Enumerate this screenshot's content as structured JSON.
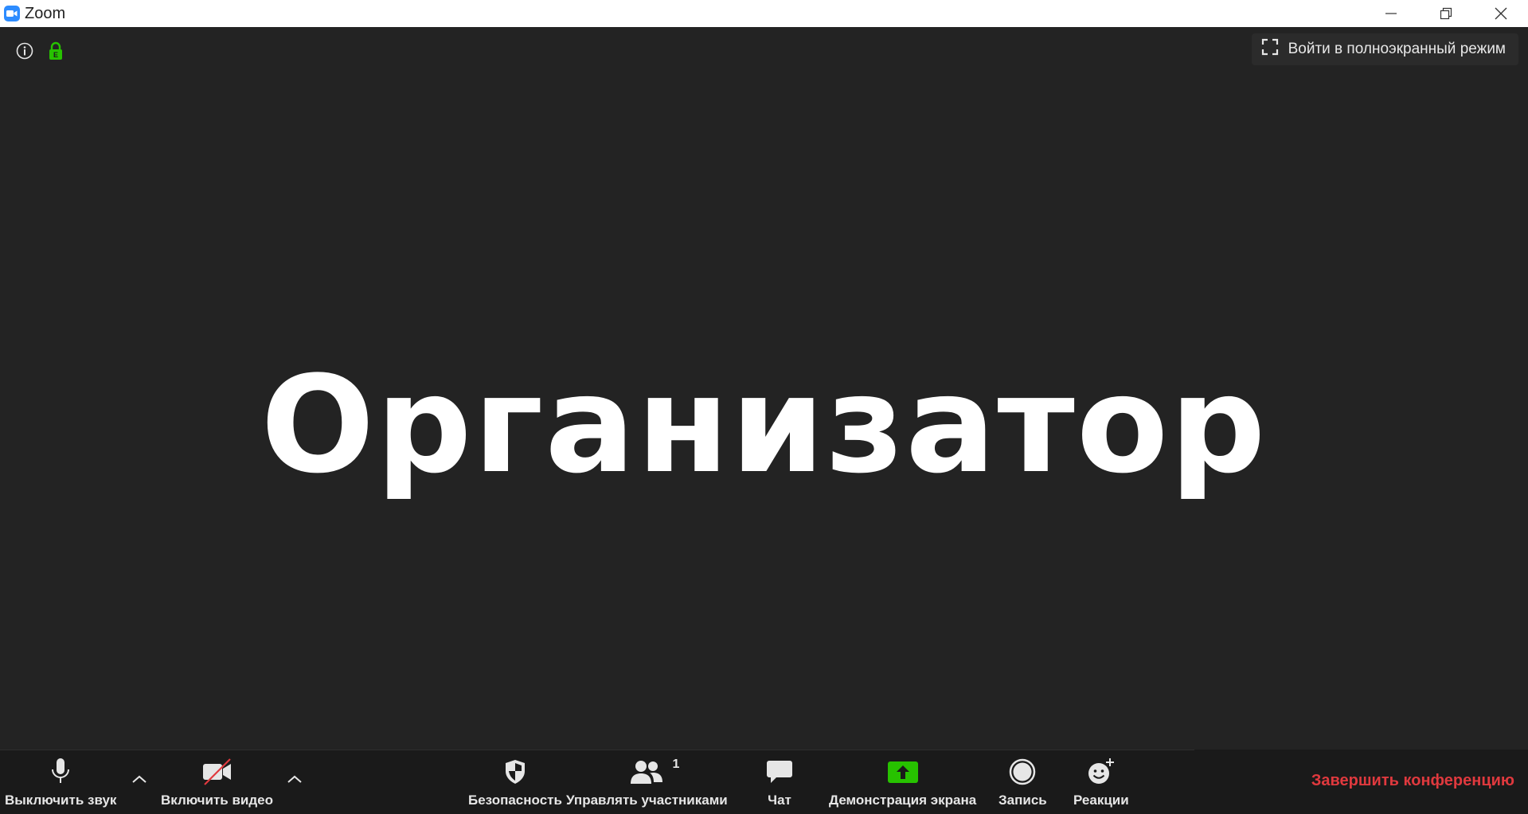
{
  "window": {
    "title": "Zoom"
  },
  "meeting": {
    "fullscreen_label": "Войти в полноэкранный режим",
    "speaker_name": "Организатор"
  },
  "toolbar": {
    "mute_label": "Выключить звук",
    "video_label": "Включить видео",
    "security_label": "Безопасность",
    "participants_label": "Управлять участниками",
    "participants_count": "1",
    "chat_label": "Чат",
    "share_label": "Демонстрация экрана",
    "record_label": "Запись",
    "reactions_label": "Реакции",
    "end_label": "Завершить конференцию"
  },
  "colors": {
    "accent": "#2d8cff",
    "share_green": "#27c200",
    "end_red": "#e0393e",
    "lock_green": "#27c200",
    "video_off_red": "#e0393e"
  }
}
